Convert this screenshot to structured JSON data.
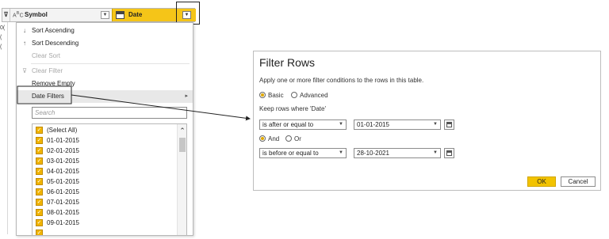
{
  "grid": {
    "row_labels": [
      "0(",
      "(",
      "("
    ]
  },
  "column_header": {
    "symbol_type_icon": "A B C type icon",
    "symbol_label": "Symbol",
    "date_label": "Date",
    "filter_icon": "filter-icon",
    "date_type_icon": "calendar-icon",
    "dropdown_icon": "chevron-down-icon"
  },
  "menu": {
    "items": [
      {
        "label": "Sort Ascending",
        "icon": "sort-ascending-icon",
        "enabled": true
      },
      {
        "label": "Sort Descending",
        "icon": "sort-descending-icon",
        "enabled": true
      },
      {
        "label": "Clear Sort",
        "icon": "",
        "enabled": false
      },
      {
        "label": "Clear Filter",
        "icon": "clear-filter-icon",
        "enabled": false
      },
      {
        "label": "Remove Empty",
        "icon": "",
        "enabled": true
      },
      {
        "label": "Date Filters",
        "icon": "",
        "enabled": true,
        "has_submenu": true
      }
    ],
    "search_placeholder": "Search",
    "list_items": [
      "(Select All)",
      "01-01-2015",
      "02-01-2015",
      "03-01-2015",
      "04-01-2015",
      "05-01-2015",
      "06-01-2015",
      "07-01-2015",
      "08-01-2015",
      "09-01-2015"
    ]
  },
  "dialog": {
    "title": "Filter Rows",
    "description": "Apply one or more filter conditions to the rows in this table.",
    "mode_basic": "Basic",
    "mode_advanced": "Advanced",
    "selected_mode": "Basic",
    "keep_rows_label": "Keep rows where 'Date'",
    "condition1": {
      "operator": "is after or equal to",
      "value": "01-01-2015"
    },
    "logic_and": "And",
    "logic_or": "Or",
    "selected_logic": "And",
    "condition2": {
      "operator": "is before or equal to",
      "value": "28-10-2021"
    },
    "ok_label": "OK",
    "cancel_label": "Cancel"
  },
  "colors": {
    "accent": "#F2C300",
    "date_column": "#F5C518",
    "checkbox": "#F0B400"
  }
}
